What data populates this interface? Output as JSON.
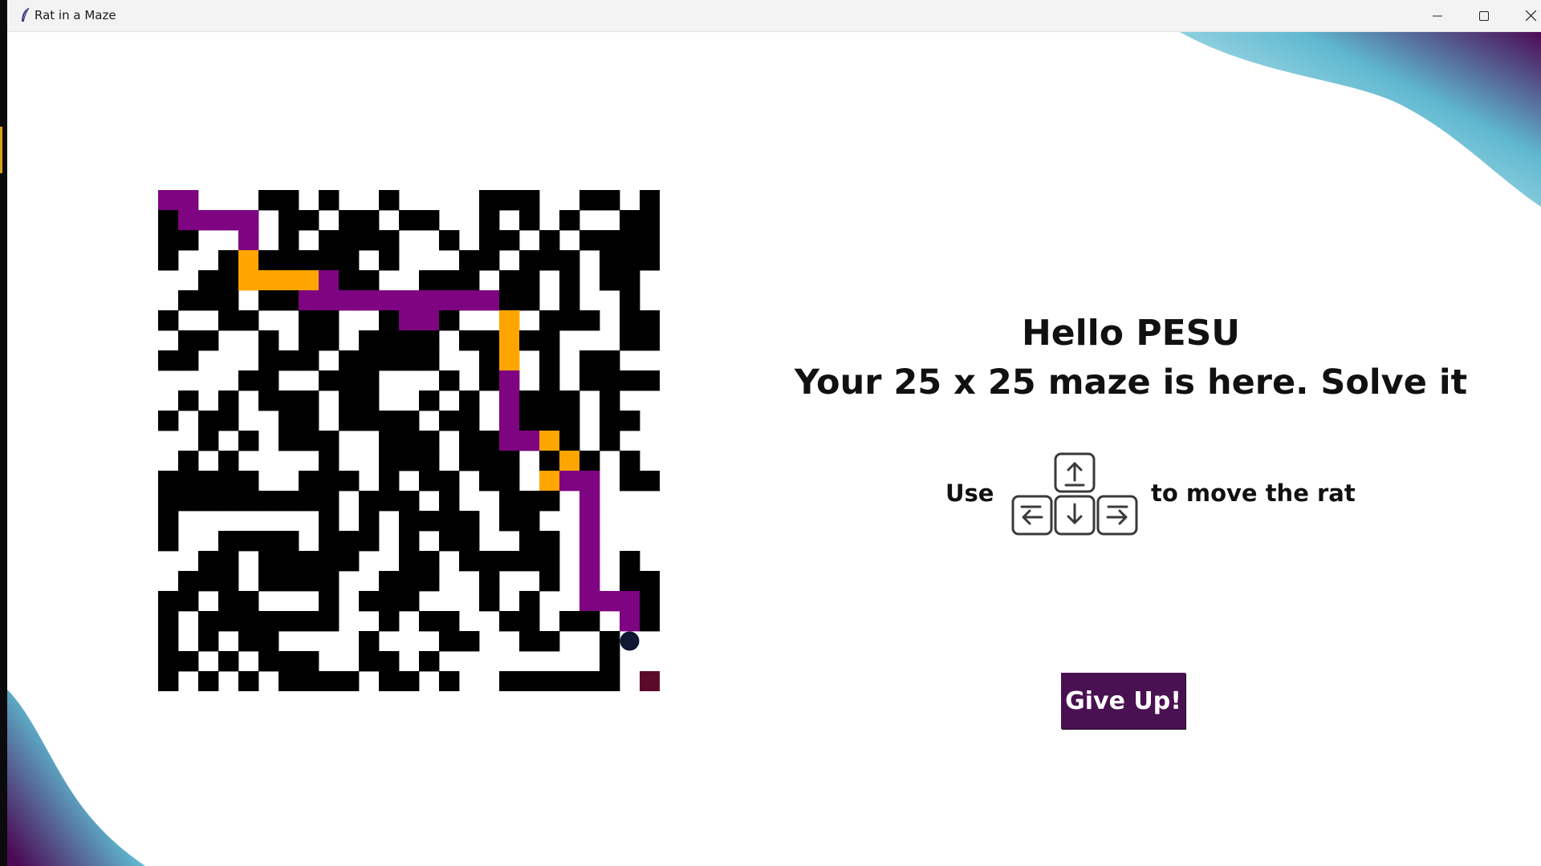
{
  "window": {
    "title": "Rat in a Maze",
    "controls": [
      "minimize-icon",
      "maximize-icon",
      "close-icon"
    ]
  },
  "header": {
    "greeting": "Hello PESU",
    "subtitle": "Your 25 x 25 maze is here. Solve it"
  },
  "instructions": {
    "prefix": "Use",
    "icon": "arrow-keys-icon",
    "suffix": "to move the rat"
  },
  "actions": {
    "give_up_label": "Give Up!"
  },
  "maze": {
    "rows": 25,
    "cols": 25,
    "legend": {
      "#": "wall",
      ".": "open",
      "P": "travelled path",
      "O": "backtracked path",
      "R": "rat",
      "E": "exit"
    },
    "grid": [
      "PP...##.#..#....###..##.#",
      "#PPPP.##.##.##..#.#.#..##",
      "##..P.#.####..#.##.#.####",
      "#..#O#####.#...##.###.###",
      "..##OOOOP##..###.##.#.##.",
      ".###.##PPPPPPPPPP##.#..#.",
      "#..##..##..#PP#..O.###.##",
      ".##..#.##.####.##O##...##",
      "##...###.#####..#O.#.##..",
      "....##..###...#.#P.#.####",
      ".#.#.###.##..#.#.P###.#..",
      "#.##..##.####.##.P###.##.",
      "..#.#.###..###.##PPO#.#..",
      ".#.#....#..###.###.#O#.#.",
      "#####..###.#.##.##.OPP.##",
      "#########.###.#..###.P...",
      "#.......#.#.####.##..P...",
      "#..####.###.#.##..##.P...",
      "..##.#####..##.#####.P.#.",
      ".###.####..###..#..#.P.##",
      "##.##...#.###...#.#..PPP#",
      "#.#######..#.##..##.##.P#",
      "#.#.##....#...##..##..#R.",
      "##.#.###..##.#........#..",
      "#.#.#.####.##.#..######.E"
    ]
  },
  "colors": {
    "wall": "#000000",
    "open": "#ffffff",
    "path": "#7e0481",
    "backtrack": "#ffa500",
    "rat": "#0f1733",
    "exit": "#5c0a2a",
    "button_bg": "#4a1152",
    "button_text": "#ffffff",
    "gradient_dark": "#4c0a55",
    "gradient_light": "#5fb8cf"
  }
}
